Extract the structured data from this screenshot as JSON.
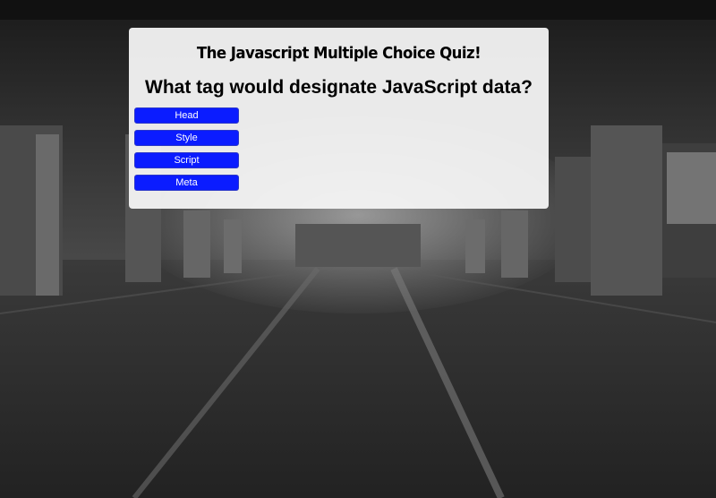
{
  "quiz": {
    "title": "The Javascript Multiple Choice Quiz!",
    "question": "What tag would designate JavaScript data?",
    "answers": [
      "Head",
      "Style",
      "Script",
      "Meta"
    ],
    "button_color": "#0b1cff"
  }
}
